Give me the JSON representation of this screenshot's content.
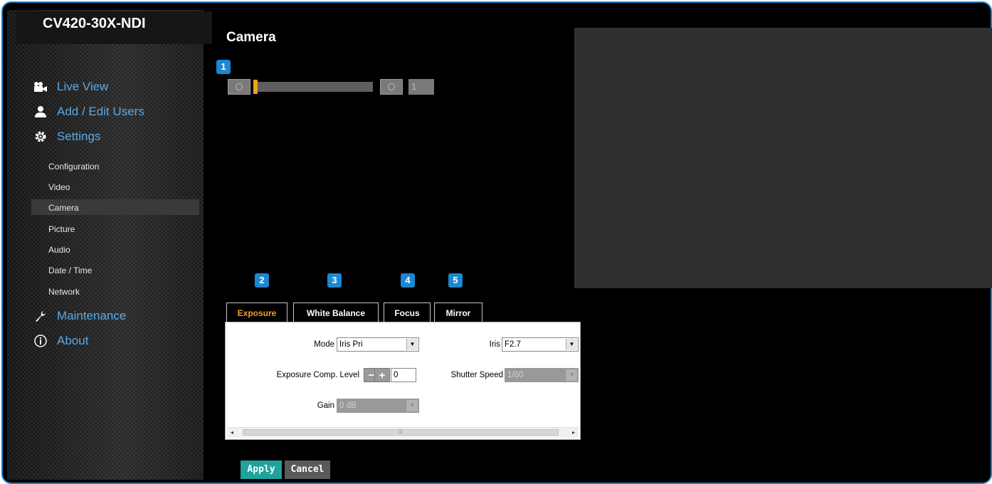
{
  "app": {
    "title": "CV420-30X-NDI"
  },
  "sidebar": {
    "main_items": [
      {
        "label": "Live View",
        "icon": "camera-icon"
      },
      {
        "label": "Add / Edit Users",
        "icon": "user-icon"
      },
      {
        "label": "Settings",
        "icon": "gear-icon"
      },
      {
        "label": "Maintenance",
        "icon": "wrench-icon"
      },
      {
        "label": "About",
        "icon": "info-icon"
      }
    ],
    "sub_items": [
      {
        "label": "Configuration"
      },
      {
        "label": "Video"
      },
      {
        "label": "Camera",
        "active": true
      },
      {
        "label": "Picture"
      },
      {
        "label": "Audio"
      },
      {
        "label": "Date / Time"
      },
      {
        "label": "Network"
      }
    ]
  },
  "main": {
    "title": "Camera",
    "zoom": {
      "value": "1",
      "level": 0
    },
    "badges": [
      "1",
      "2",
      "3",
      "4",
      "5"
    ],
    "tabs": [
      {
        "label": "Exposure",
        "active": true
      },
      {
        "label": "White Balance"
      },
      {
        "label": "Focus"
      },
      {
        "label": "Mirror"
      }
    ],
    "exposure": {
      "mode_label": "Mode",
      "mode_value": "Iris Pri",
      "iris_label": "Iris",
      "iris_value": "F2.7",
      "comp_label": "Exposure Comp. Level",
      "minus": "−",
      "plus": "+",
      "comp_value": "0",
      "shutter_label": "Shutter Speed",
      "shutter_value": "1/60",
      "gain_label": "Gain",
      "gain_value": "0 dB"
    },
    "apply_label": "Apply",
    "cancel_label": "Cancel"
  },
  "colors": {
    "accent": "#1d87d0",
    "active_tab": "#f0a020",
    "apply": "#1fa39b",
    "cancel": "#5a5a5a",
    "nav_link": "#5aa9e6"
  }
}
